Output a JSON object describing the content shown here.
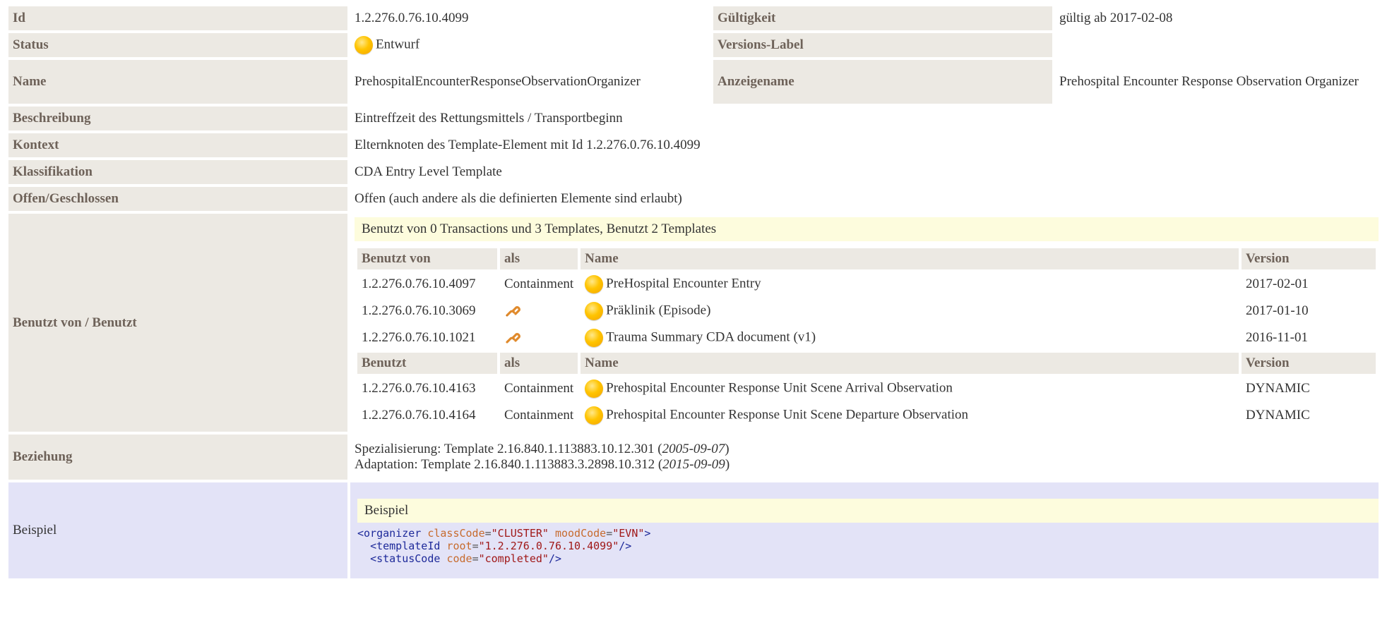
{
  "rows": {
    "id": {
      "label": "Id",
      "value": "1.2.276.0.76.10.4099"
    },
    "validity": {
      "label": "Gültigkeit",
      "value": "gültig ab 2017-02-08"
    },
    "status": {
      "label": "Status",
      "value": "Entwurf"
    },
    "version_label": {
      "label": "Versions-Label",
      "value": ""
    },
    "name": {
      "label": "Name",
      "value": "PrehospitalEncounterResponseObservationOrganizer"
    },
    "display_name": {
      "label": "Anzeigename",
      "value": "Prehospital Encounter Response Observation Organizer"
    },
    "description": {
      "label": "Beschreibung",
      "value": "Eintreffzeit des Rettungsmittels / Transportbeginn"
    },
    "context": {
      "label": "Kontext",
      "value": "Elternknoten des Template-Element mit Id 1.2.276.0.76.10.4099"
    },
    "classification": {
      "label": "Klassifikation",
      "value": "CDA Entry Level Template"
    },
    "open_closed": {
      "label": "Offen/Geschlossen",
      "value": "Offen (auch andere als die definierten Elemente sind erlaubt)"
    },
    "used_by": {
      "label": "Benutzt von / Benutzt"
    },
    "relationship": {
      "label": "Beziehung"
    },
    "example": {
      "label": "Beispiel"
    }
  },
  "usage": {
    "summary": "Benutzt von 0 Transactions und 3 Templates, Benutzt 2 Templates",
    "used_by_headers": {
      "id": "Benutzt von",
      "as": "als",
      "name": "Name",
      "version": "Version"
    },
    "used_by_rows": [
      {
        "id": "1.2.276.0.76.10.4097",
        "as": "Containment",
        "name": "PreHospital Encounter Entry",
        "version": "2017-02-01"
      },
      {
        "id": "1.2.276.0.76.10.3069",
        "as": "",
        "name": "Präklinik (Episode)",
        "version": "2017-01-10"
      },
      {
        "id": "1.2.276.0.76.10.1021",
        "as": "",
        "name": "Trauma Summary CDA document (v1)",
        "version": "2016-11-01"
      }
    ],
    "uses_headers": {
      "id": "Benutzt",
      "as": "als",
      "name": "Name",
      "version": "Version"
    },
    "uses_rows": [
      {
        "id": "1.2.276.0.76.10.4163",
        "as": "Containment",
        "name": "Prehospital Encounter Response Unit Scene Arrival Observation",
        "version": "DYNAMIC"
      },
      {
        "id": "1.2.276.0.76.10.4164",
        "as": "Containment",
        "name": "Prehospital Encounter Response Unit Scene Departure Observation",
        "version": "DYNAMIC"
      }
    ]
  },
  "relationship": {
    "line1_prefix": "Spezialisierung: Template 2.16.840.1.113883.10.12.301 (",
    "line1_date": "2005-09-07",
    "line2_prefix": "Adaptation: Template 2.16.840.1.113883.3.2898.10.312 (",
    "line2_date": "2015-09-09",
    "close": ")"
  },
  "example": {
    "title": "Beispiel",
    "code": {
      "l1_tag": "<organizer",
      "l1_a1": "classCode",
      "l1_v1": "\"CLUSTER\"",
      "l1_a2": "moodCode",
      "l1_v2": "\"EVN\"",
      "l1_end": ">",
      "l2_tag": "<templateId",
      "l2_a1": "root",
      "l2_v1": "\"1.2.276.0.76.10.4099\"",
      "l2_end": "/>",
      "l3_tag": "<statusCode",
      "l3_a1": "code",
      "l3_v1": "\"completed\"",
      "l3_end": "/>"
    }
  }
}
